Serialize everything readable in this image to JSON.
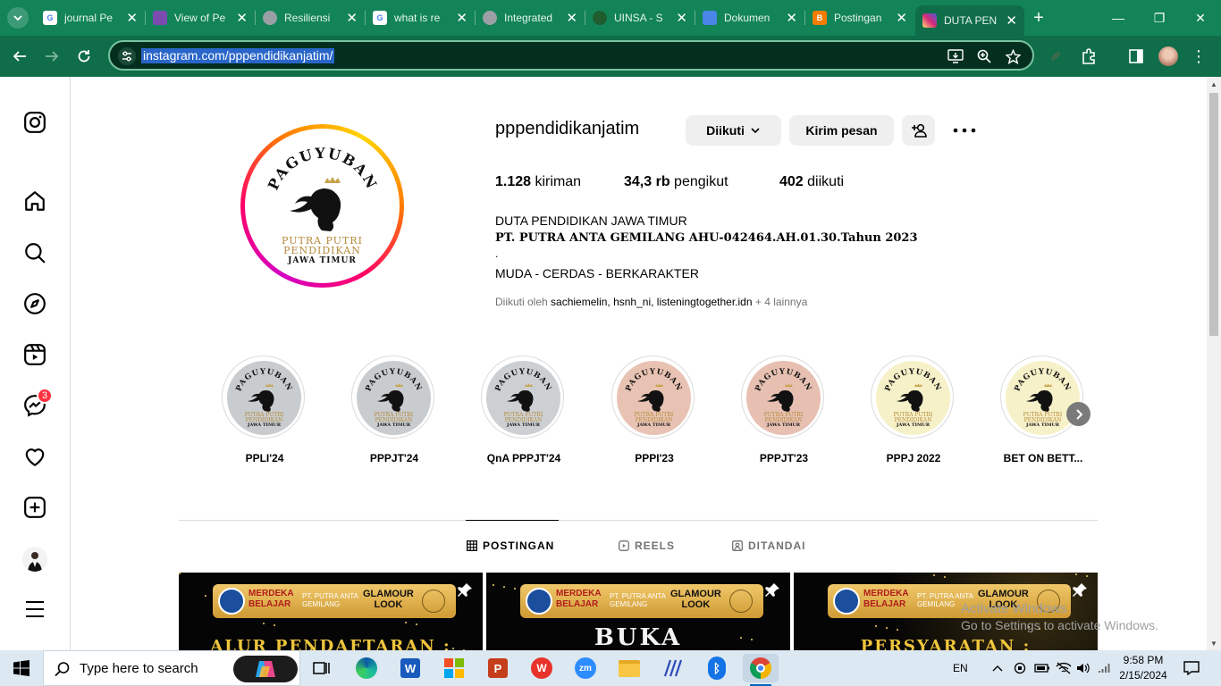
{
  "browser": {
    "tabs": [
      {
        "title": "journal Pe",
        "fav_color": "#ffffff",
        "fav_glyph": "G",
        "active": false
      },
      {
        "title": "View of Pe",
        "fav_color": "#7b4bb0",
        "fav_glyph": "",
        "active": false
      },
      {
        "title": "Resiliensi",
        "fav_color": "#9aa0a6",
        "fav_glyph": "",
        "active": false
      },
      {
        "title": "what is re",
        "fav_color": "#ffffff",
        "fav_glyph": "G",
        "active": false
      },
      {
        "title": "Integrated",
        "fav_color": "#9aa0a6",
        "fav_glyph": "",
        "active": false
      },
      {
        "title": "UINSA - S",
        "fav_color": "#1f5d2e",
        "fav_glyph": "",
        "active": false
      },
      {
        "title": "Dokumen",
        "fav_color": "#4a86e8",
        "fav_glyph": "",
        "active": false
      },
      {
        "title": "Postingan",
        "fav_color": "#f57c00",
        "fav_glyph": "B",
        "active": false
      },
      {
        "title": "DUTA PEN",
        "fav_color": "#e1306c",
        "fav_glyph": "",
        "active": true
      }
    ],
    "url": "instagram.com/pppendidikanjatim/",
    "icons": {
      "back": "arrow-left-icon",
      "forward": "arrow-right-icon",
      "reload": "reload-icon",
      "tab_search": "chevron-down-icon",
      "new_tab": "plus-icon",
      "install": "install-app-icon",
      "zoom": "zoom-icon",
      "bookmark": "star-icon",
      "extensions": "puzzle-icon",
      "sidepanel": "side-panel-icon",
      "profile": "profile-avatar-icon"
    }
  },
  "sidebar": {
    "items": [
      {
        "name": "instagram-logo-icon"
      },
      {
        "name": "home-icon"
      },
      {
        "name": "search-icon"
      },
      {
        "name": "explore-icon"
      },
      {
        "name": "reels-icon"
      },
      {
        "name": "messages-icon",
        "badge": "3"
      },
      {
        "name": "notifications-heart-icon"
      },
      {
        "name": "create-icon"
      },
      {
        "name": "profile-avatar"
      },
      {
        "name": "menu-icon"
      }
    ]
  },
  "profile": {
    "username": "pppendidikanjatim",
    "follow_button": "Diikuti",
    "message_button": "Kirim pesan",
    "stats": {
      "posts_value": "1.128",
      "posts_label": "kiriman",
      "followers_value": "34,3 rb",
      "followers_label": "pengikut",
      "following_value": "402",
      "following_label": "diikuti"
    },
    "bio": {
      "name": "DUTA PENDIDIKAN JAWA TIMUR",
      "line1": "PT. PUTRA ANTA GEMILANG AHU-042464.AH.01.30.Tahun 2023",
      "line2": ".",
      "line3": "MUDA - CERDAS - BERKARAKTER"
    },
    "followed_by": {
      "prefix": "Diikuti oleh",
      "names": "sachiemelin, hsnh_ni, listeningtogether.idn",
      "suffix": "+ 4 lainnya"
    },
    "logo": {
      "arc_text": "PAGUYUBAN",
      "line_a": "PUTRA PUTRI",
      "line_b": "PENDIDIKAN",
      "line_c": "JAWA TIMUR"
    }
  },
  "highlights": [
    {
      "label": "PPLI'24",
      "bg": "#c9cccf"
    },
    {
      "label": "PPPJT'24",
      "bg": "#c9cccf"
    },
    {
      "label": "QnA PPPJT'24",
      "bg": "#cdd0d3"
    },
    {
      "label": "PPPI'23",
      "bg": "#e8c3b3"
    },
    {
      "label": "PPPJT'23",
      "bg": "#e7c0b2"
    },
    {
      "label": "PPPJ 2022",
      "bg": "#f7f1c9"
    },
    {
      "label": "BET ON BETT...",
      "bg": "#f7f1c9"
    }
  ],
  "tabs": [
    {
      "label": "POSTINGAN",
      "icon": "grid-icon",
      "active": true
    },
    {
      "label": "REELS",
      "icon": "reels-tab-icon",
      "active": false
    },
    {
      "label": "DITANDAI",
      "icon": "tagged-icon",
      "active": false
    }
  ],
  "posts": [
    {
      "headline": "ALUR PENDAFTARAN :"
    },
    {
      "headline": "BUKA PENDAFTARAN"
    },
    {
      "headline": "PERSYARATAN :"
    }
  ],
  "post_banner": {
    "merdeka": "MERDEKA",
    "belajar": "BELAJAR",
    "pt_line1": "PT. PUTRA ANTA",
    "pt_line2": "GEMILANG",
    "glamour": "GLAMOUR",
    "look": "LOOK"
  },
  "watermark": {
    "line1": "Activate Windows",
    "line2": "Go to Settings to activate Windows."
  },
  "taskbar": {
    "search_placeholder": "Type here to search",
    "language": "EN",
    "time": "9:58 PM",
    "date": "2/15/2024",
    "apps": [
      "task-view-icon",
      "edge-icon",
      "word-icon",
      "store-icon",
      "powerpoint-icon",
      "wps-icon",
      "zoom-app-icon",
      "file-explorer-icon",
      "vscode-like-icon",
      "bluetooth-icon",
      "chrome-icon"
    ]
  }
}
